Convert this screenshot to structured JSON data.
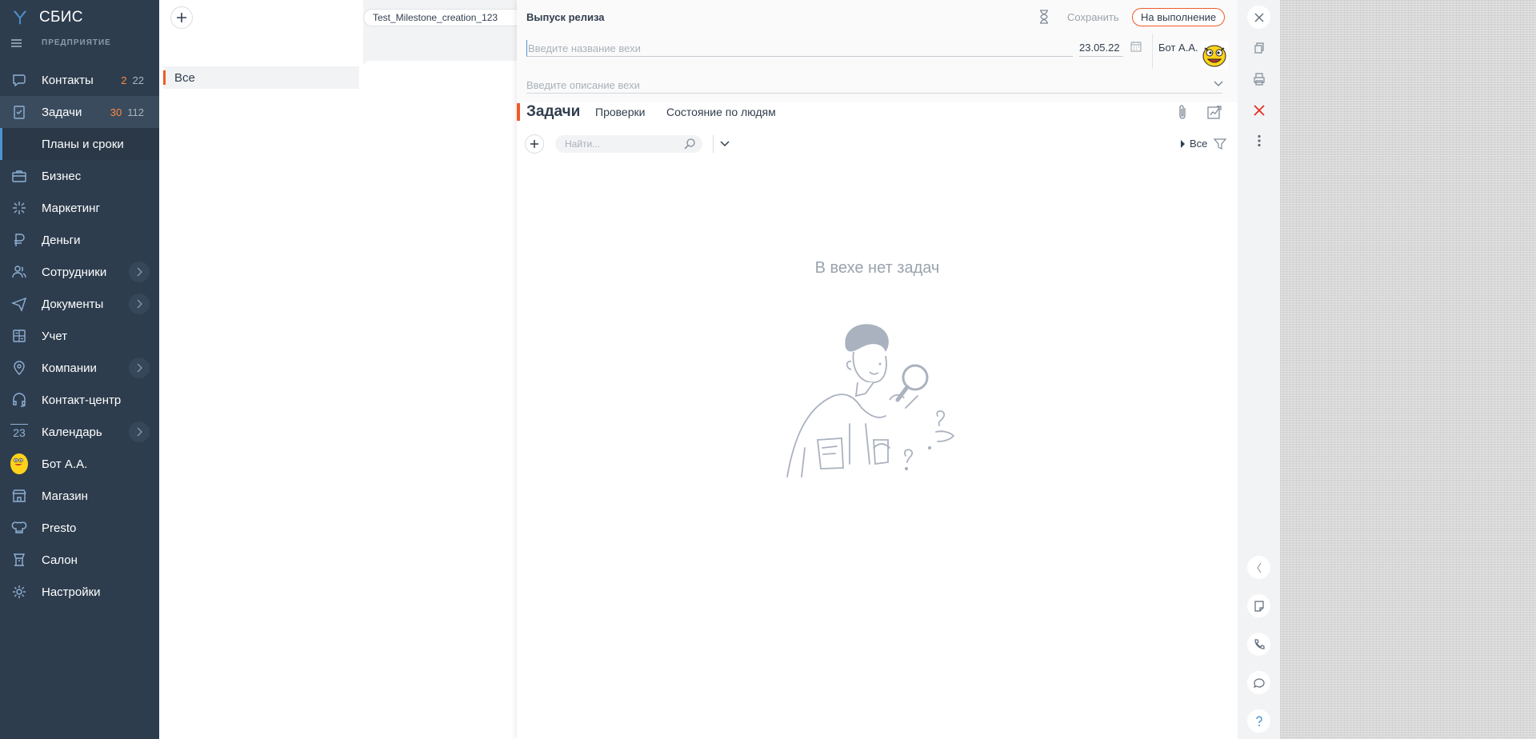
{
  "brand": {
    "name": "СБИС",
    "company_label": "ПРЕДПРИЯТИЕ"
  },
  "nav": {
    "items": [
      {
        "label": "Контакты",
        "icon": "chat-icon",
        "badge_new": "2",
        "badge_total": "22"
      },
      {
        "label": "Задачи",
        "icon": "tasks-icon",
        "badge_new": "30",
        "badge_total": "112"
      },
      {
        "label": "Планы и сроки",
        "sub": true
      },
      {
        "label": "Бизнес",
        "icon": "briefcase-icon"
      },
      {
        "label": "Маркетинг",
        "icon": "sparkle-icon"
      },
      {
        "label": "Деньги",
        "icon": "ruble-icon"
      },
      {
        "label": "Сотрудники",
        "icon": "people-icon",
        "expandable": true
      },
      {
        "label": "Документы",
        "icon": "send-icon",
        "expandable": true
      },
      {
        "label": "Учет",
        "icon": "calculator-icon"
      },
      {
        "label": "Компании",
        "icon": "location-icon",
        "expandable": true
      },
      {
        "label": "Контакт-центр",
        "icon": "headset-icon"
      },
      {
        "label": "Календарь",
        "icon": "calendar-day-icon",
        "day": "23",
        "expandable": true
      },
      {
        "label": "Бот А.А.",
        "icon": "user-avatar"
      },
      {
        "label": "Магазин",
        "icon": "store-icon"
      },
      {
        "label": "Presto",
        "icon": "chef-icon"
      },
      {
        "label": "Салон",
        "icon": "salon-icon"
      },
      {
        "label": "Настройки",
        "icon": "gear-icon"
      }
    ]
  },
  "list": {
    "folder": "Все",
    "chip": "Test_Milestone_creation_123"
  },
  "dialog": {
    "title": "Выпуск релиза",
    "save": "Сохранить",
    "status": "На выполнение",
    "name_placeholder": "Введите название вехи",
    "date": "23.05.22",
    "responsible": "Бот А.А.",
    "desc_placeholder": "Введите описание вехи",
    "tabs": [
      "Задачи",
      "Проверки",
      "Состояние по людям"
    ],
    "search_placeholder": "Найти...",
    "filter_label": "Все",
    "empty_text": "В вехе нет задач"
  },
  "colors": {
    "nav_bg": "#2e3d4e",
    "accent": "#f05a28",
    "active_bar": "#4c93d4",
    "badge_new": "#ff8a3c"
  }
}
